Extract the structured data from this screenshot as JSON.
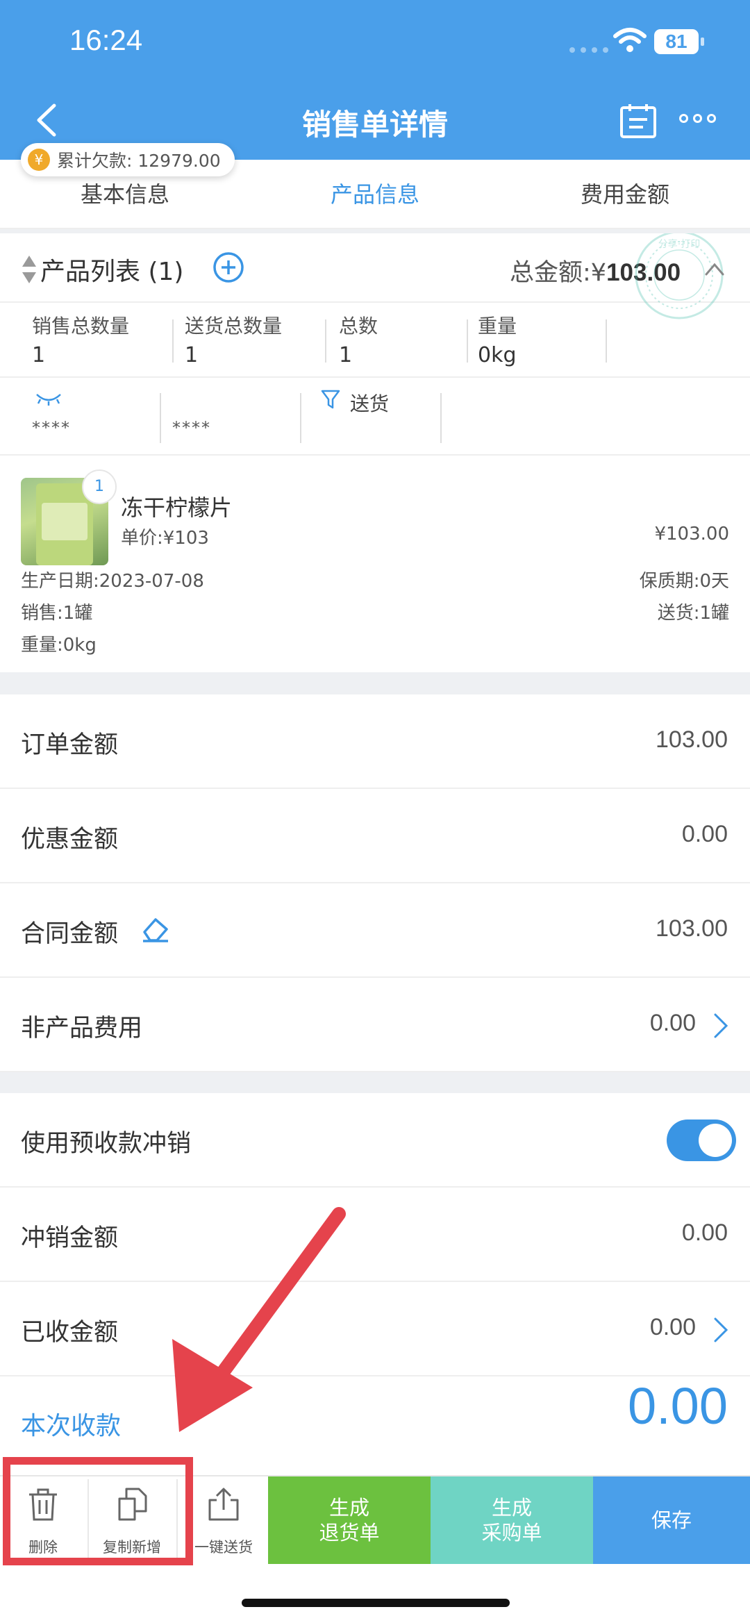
{
  "status_bar": {
    "time": "16:24",
    "battery": "81"
  },
  "header": {
    "title": "销售单详情"
  },
  "debt": {
    "currency_symbol": "¥",
    "text": "累计欠款: 12979.00"
  },
  "tabs": [
    {
      "label": "基本信息",
      "active": false
    },
    {
      "label": "产品信息",
      "active": true
    },
    {
      "label": "费用金额",
      "active": false
    }
  ],
  "product_list": {
    "title": "产品列表 (1)",
    "total_label": "总金额:¥",
    "total_value": "103.00",
    "stamp_text": "分享·打印"
  },
  "stats": [
    {
      "label": "销售总数量",
      "value": "1"
    },
    {
      "label": "送货总数量",
      "value": "1"
    },
    {
      "label": "总数",
      "value": "1"
    },
    {
      "label": "重量",
      "value": "0kg"
    }
  ],
  "filters": {
    "mask1": "****",
    "mask2": "****",
    "delivery_filter": "送货"
  },
  "product": {
    "qty_badge": "1",
    "name": "冻干柠檬片",
    "unit_price": "单价:¥103",
    "line_total": "¥103.00",
    "production_date": "生产日期:2023-07-08",
    "shelf_life": "保质期:0天",
    "sale_qty": "销售:1罐",
    "delivery_qty": "送货:1罐",
    "weight": "重量:0kg"
  },
  "amounts": {
    "order_amount": {
      "label": "订单金额",
      "value": "103.00"
    },
    "discount_amount": {
      "label": "优惠金额",
      "value": "0.00"
    },
    "contract_amount": {
      "label": "合同金额",
      "value": "103.00"
    },
    "non_product_fee": {
      "label": "非产品费用",
      "value": "0.00"
    },
    "use_prepayment": {
      "label": "使用预收款冲销",
      "enabled": true
    },
    "offset_amount": {
      "label": "冲销金额",
      "value": "0.00"
    },
    "received_amount": {
      "label": "已收金额",
      "value": "0.00"
    },
    "this_receipt": {
      "label": "本次收款",
      "value": "0.00"
    }
  },
  "bottom_bar": {
    "delete": "删除",
    "copy_new": "复制新增",
    "one_click_delivery": "一键送货",
    "return_line1": "生成",
    "return_line2": "退货单",
    "purchase_line1": "生成",
    "purchase_line2": "采购单",
    "save": "保存"
  },
  "colors": {
    "primary": "#4a9fea",
    "accent_blue": "#3a95e4",
    "return_green": "#6cc13f",
    "purchase_teal": "#6fd4c4",
    "save_blue": "#4a9fea",
    "annotation_red": "#e5434c",
    "coin_orange": "#f0a92a"
  }
}
